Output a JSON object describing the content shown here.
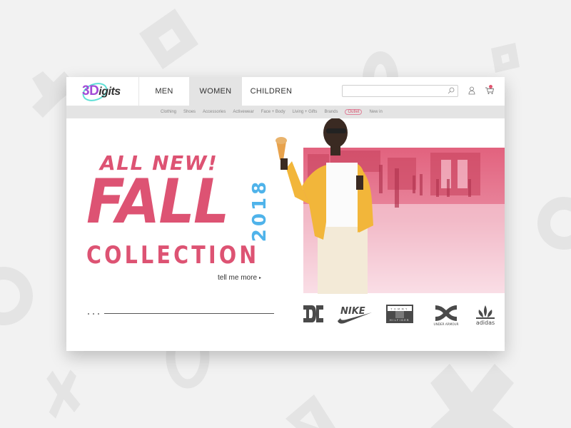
{
  "logo": {
    "part1": "3D",
    "part2": "igits"
  },
  "nav": {
    "tabs": [
      {
        "label": "MEN",
        "active": false
      },
      {
        "label": "WOMEN",
        "active": true
      },
      {
        "label": "CHILDREN",
        "active": false
      }
    ]
  },
  "search": {
    "placeholder": "",
    "value": ""
  },
  "cart": {
    "badge_color": "#e2546f"
  },
  "subnav": {
    "items": [
      "Clothing",
      "Shoes",
      "Accessories",
      "Activewear",
      "Face + Body",
      "Living + Gifts",
      "Brands",
      "Outlet",
      "New in"
    ]
  },
  "hero": {
    "kicker": "ALL NEW!",
    "headline": "FALL",
    "subhead": "COLLECTION",
    "year": "2018",
    "cta": "tell me more",
    "cta_arrow": "▸",
    "accent_pink": "#dd5373",
    "accent_blue": "#4fb3ea"
  },
  "slider": {
    "dots": 3,
    "active_index": 3
  },
  "brands": {
    "items": [
      "DC",
      "NIKE",
      "TOMMY HILFIGER",
      "UNDER ARMOUR",
      "adidas"
    ],
    "tommy_top": "TOMMY",
    "tommy_bottom": "HILFIGER",
    "ua_text": "UNDER ARMOUR",
    "adidas_text": "adidas",
    "nike_text": "NIKE"
  }
}
